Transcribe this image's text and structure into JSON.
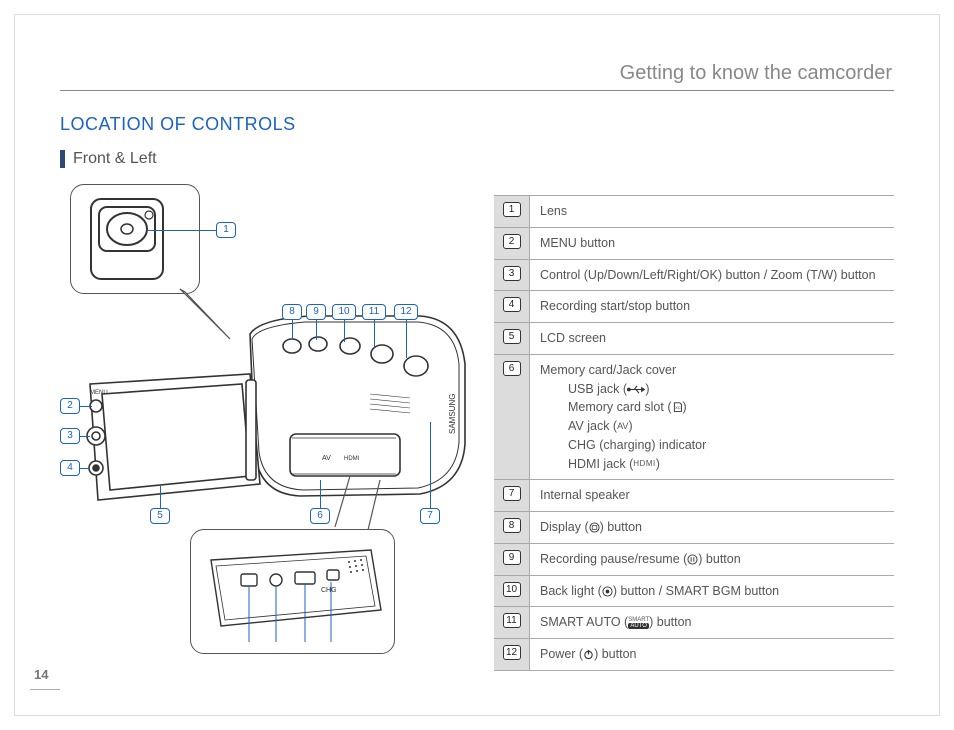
{
  "page": {
    "number": "14"
  },
  "chapter": {
    "title": "Getting to know the camcorder"
  },
  "section": {
    "title": "LOCATION OF CONTROLS"
  },
  "subhead": {
    "label": "Front & Left"
  },
  "callouts": {
    "c1": "1",
    "c2": "2",
    "c3": "3",
    "c4": "4",
    "c5": "5",
    "c6": "6",
    "c7": "7",
    "c8": "8",
    "c9": "9",
    "c10": "10",
    "c11": "11",
    "c12": "12"
  },
  "legend": [
    {
      "num": "1",
      "text": "Lens"
    },
    {
      "num": "2",
      "text": "MENU button"
    },
    {
      "num": "3",
      "text": "Control (Up/Down/Left/Right/OK) button / Zoom (T/W) button"
    },
    {
      "num": "4",
      "text": "Recording start/stop button"
    },
    {
      "num": "5",
      "text": "LCD screen"
    },
    {
      "num": "6",
      "text": "Memory card/Jack cover",
      "sub": [
        {
          "label": "USB jack (",
          "icon": "usb",
          "tail": ")"
        },
        {
          "label": "Memory card slot (",
          "icon": "sd",
          "tail": ")"
        },
        {
          "label": "AV jack (",
          "icon": "av",
          "tail": ")"
        },
        {
          "label": "CHG (charging) indicator"
        },
        {
          "label": "HDMI jack (",
          "icon": "hdmi",
          "tail": ")"
        }
      ]
    },
    {
      "num": "7",
      "text": "Internal speaker"
    },
    {
      "num": "8",
      "pre": "Display (",
      "icon": "display",
      "post": ") button"
    },
    {
      "num": "9",
      "pre": "Recording pause/resume (",
      "icon": "pause",
      "post": ") button"
    },
    {
      "num": "10",
      "pre": "Back light (",
      "icon": "backlight",
      "post": ") button / SMART BGM button"
    },
    {
      "num": "11",
      "pre": "SMART AUTO (",
      "icon": "smartauto",
      "post": ") button"
    },
    {
      "num": "12",
      "pre": "Power (",
      "icon": "power",
      "post": ") button"
    }
  ]
}
